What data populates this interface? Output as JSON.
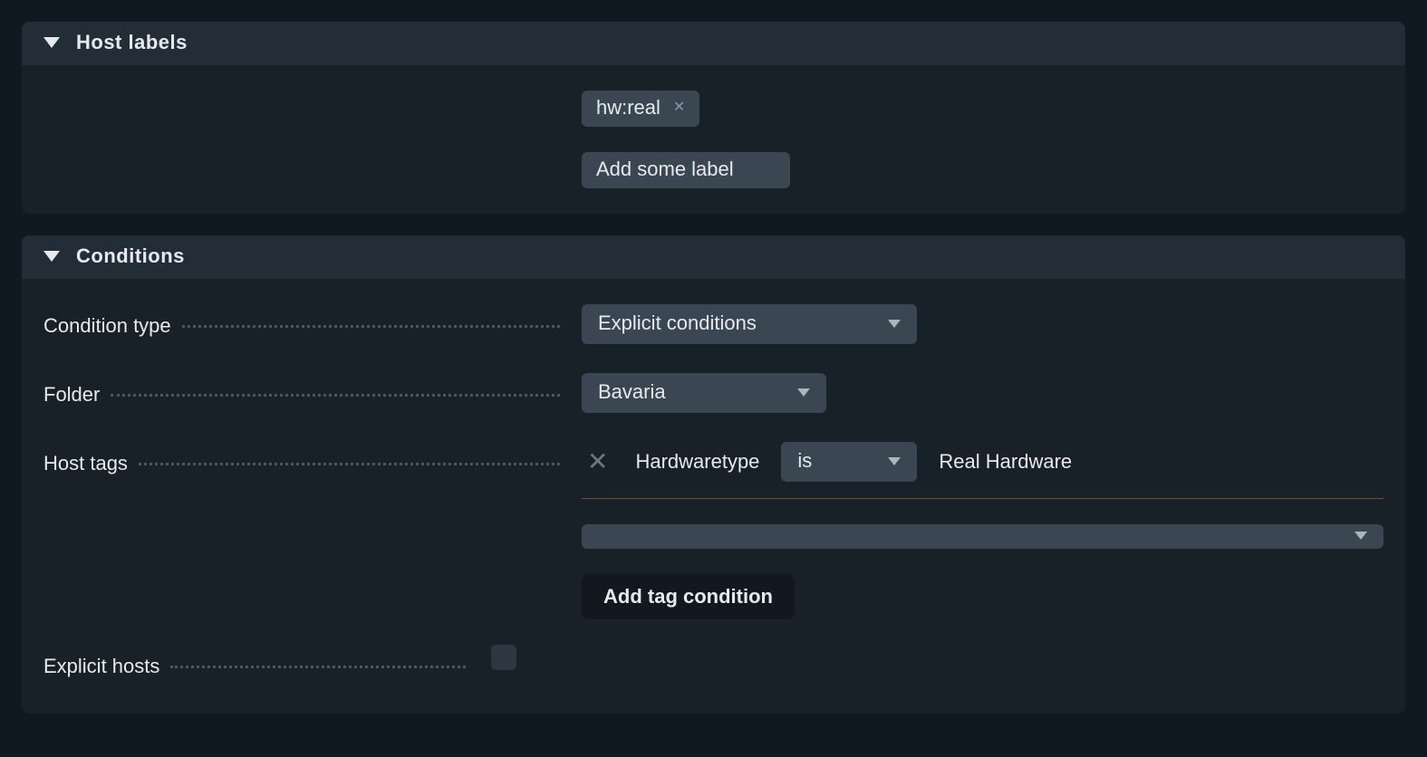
{
  "host_labels": {
    "section_title": "Host labels",
    "labels": [
      {
        "text": "hw:real"
      }
    ],
    "add_placeholder": "Add some label"
  },
  "conditions": {
    "section_title": "Conditions",
    "condition_type": {
      "label": "Condition type",
      "value": "Explicit conditions"
    },
    "folder": {
      "label": "Folder",
      "value": "Bavaria"
    },
    "host_tags": {
      "label": "Host tags",
      "rows": [
        {
          "tag_group": "Hardwaretype",
          "operator": "is",
          "value": "Real Hardware"
        }
      ],
      "empty_select_value": "",
      "add_button": "Add tag condition"
    },
    "explicit_hosts": {
      "label": "Explicit hosts",
      "checked": false
    }
  }
}
